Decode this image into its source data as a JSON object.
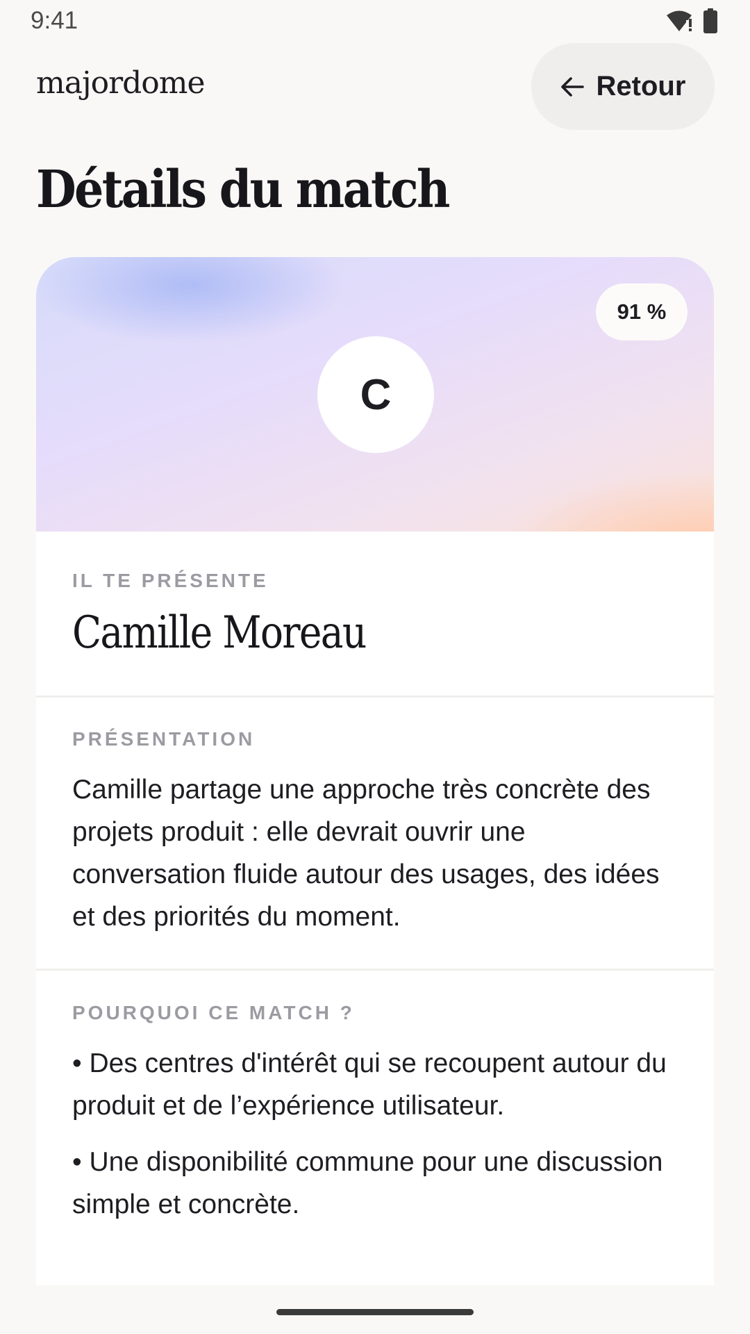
{
  "status_bar": {
    "time": "9:41",
    "icons": [
      "wifi-alert-icon",
      "battery-icon"
    ]
  },
  "header": {
    "brand": "majordome",
    "back_label": "Retour",
    "back_icon": "arrow-left-icon"
  },
  "page": {
    "title": "Détails du match"
  },
  "match": {
    "score": "91 %",
    "avatar_initial": "C",
    "presenter_label": "IL TE PRÉSENTE",
    "person_name": "Camille Moreau",
    "presentation_label": "PRÉSENTATION",
    "presentation_text": "Camille partage une approche très concrète des projets produit : elle devrait ouvrir une conversation fluide autour des usages, des idées et des priorités du moment.",
    "reasons_label": "POURQUOI CE MATCH ?",
    "reasons": [
      "• Des centres d'intérêt qui se recoupent autour du produit et de l’expérience utilisateur.",
      "• Une disponibilité commune pour une discussion simple et concrète."
    ]
  },
  "colors": {
    "background": "#f9f8f6",
    "card": "#ffffff",
    "label": "#9b9ba2",
    "text": "#17171b"
  }
}
